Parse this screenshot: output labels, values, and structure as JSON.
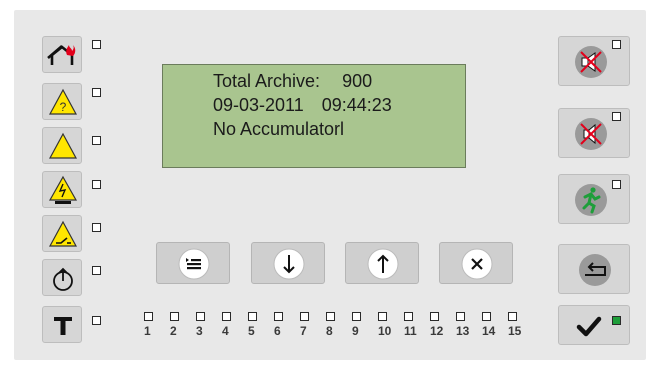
{
  "lcd": {
    "line1_label": "Total Archive:",
    "line1_value": "900",
    "line2_date": "09-03-2011",
    "line2_time": "09:44:23",
    "line3": "No Accumulatorl"
  },
  "left_indicators": [
    {
      "icon": "fire-house-icon",
      "led": "off"
    },
    {
      "icon": "warning-question-icon",
      "led": "off"
    },
    {
      "icon": "warning-icon",
      "led": "off"
    },
    {
      "icon": "warning-power-icon",
      "led": "off"
    },
    {
      "icon": "warning-switch-icon",
      "led": "off"
    },
    {
      "icon": "power-icon",
      "led": "off"
    },
    {
      "icon": "test-icon",
      "led": "off"
    }
  ],
  "right_buttons": [
    {
      "icon": "mute-sounder-icon",
      "led": "off"
    },
    {
      "icon": "mute-buzzer-icon",
      "led": "off"
    },
    {
      "icon": "evacuation-icon",
      "led": "off"
    },
    {
      "icon": "return-icon"
    },
    {
      "icon": "check-icon",
      "led": "on"
    }
  ],
  "nav_buttons": [
    "menu-icon",
    "arrow-down-icon",
    "arrow-up-icon",
    "cancel-icon"
  ],
  "zones": [
    "1",
    "2",
    "3",
    "4",
    "5",
    "6",
    "7",
    "8",
    "9",
    "10",
    "11",
    "12",
    "13",
    "14",
    "15"
  ],
  "colors": {
    "lcd": "#a9c58f",
    "led_on": "#1e9e3a",
    "warning": "#ffe600",
    "fire": "#e3001b",
    "exit": "#1e9e3a"
  }
}
